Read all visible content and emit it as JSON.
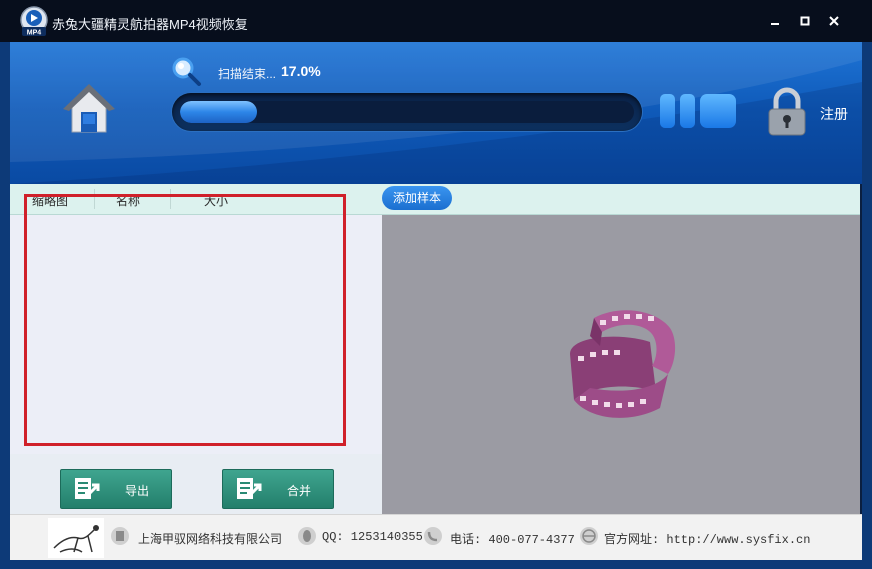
{
  "window": {
    "title": "赤兔大疆精灵航拍器MP4视频恢复",
    "icon_badge": "MP4"
  },
  "header": {
    "status_text": "扫描结束...",
    "progress_text": "17.0%",
    "progress_fraction": 0.17,
    "register_label": "注册"
  },
  "columns": [
    "缩略图",
    "名称",
    "大小"
  ],
  "buttons": {
    "add_sample": "添加样本",
    "export": "导出",
    "merge": "合并"
  },
  "footer": {
    "company": "上海甲驭网络科技有限公司",
    "qq": "QQ: 1253140355",
    "phone": "电话: 400-077-4377",
    "website": "官方网址: http://www.sysfix.cn"
  },
  "colors": {
    "highlight": "#d0202a",
    "accent_green": "#2f927c",
    "header_blue": "#1765c6"
  }
}
